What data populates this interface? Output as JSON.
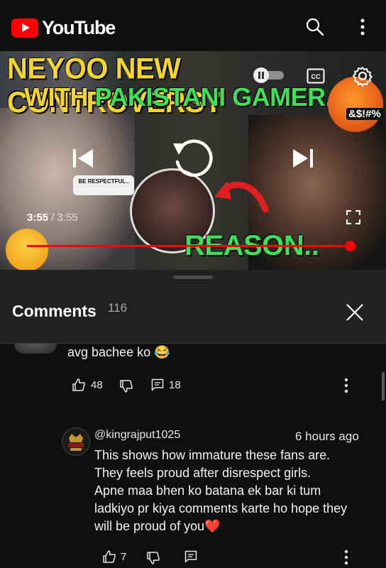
{
  "app": {
    "logo_text": "YouTube"
  },
  "header_icons": [
    "search-icon",
    "more-vert-icon"
  ],
  "video": {
    "title_overlay_line1": "NEYOO NEW CONTROVERSY",
    "title_overlay_line2a": "WITH ",
    "title_overlay_line2b": "PAKISTANI GAMER..",
    "reason_overlay": "REASON..",
    "sticker_text": "BE RESPECTFUL..",
    "emoji_text": "&$!#%",
    "current_time": "3:55",
    "separator": " / ",
    "duration": "3:55",
    "progress_fraction": 1.0,
    "accent_color": "#ff0000"
  },
  "comments_sheet": {
    "title": "Comments",
    "count": "116"
  },
  "comments": [
    {
      "text": "avg bachee ko 😂",
      "likes": "48",
      "replies": "18"
    },
    {
      "author": "@kingrajput1025",
      "time": "6 hours ago",
      "text_lines": [
        "This shows how immature these fans are.",
        "They feels proud after disrespect girls.",
        "Apne maa bhen ko batana ek bar ki tum",
        "ladkiyo pr kiya comments karte ho hope they",
        "will be proud of you❤️"
      ],
      "likes": "7"
    }
  ]
}
